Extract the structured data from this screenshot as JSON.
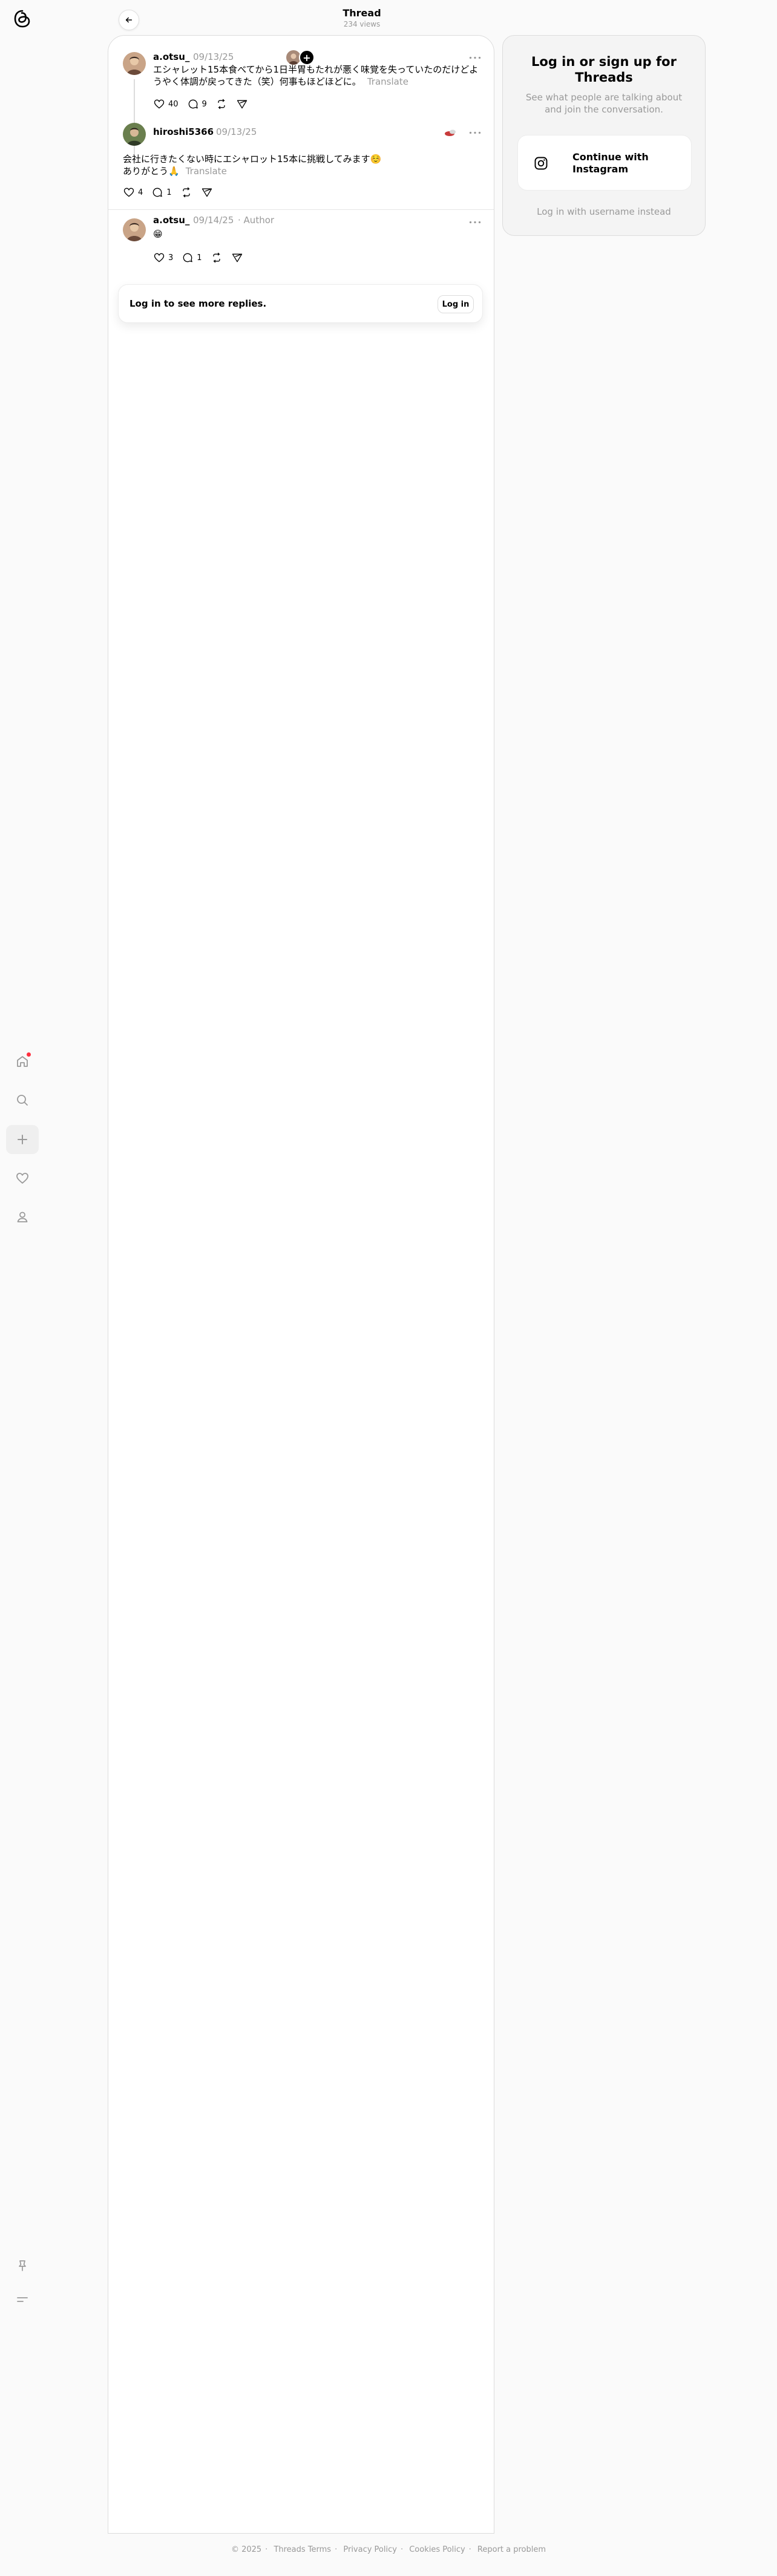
{
  "app": {
    "logo_icon": "threads-logo-icon"
  },
  "nav": {
    "items": [
      {
        "name": "home",
        "icon": "home-icon",
        "has_notification": true
      },
      {
        "name": "search",
        "icon": "search-icon"
      },
      {
        "name": "create",
        "icon": "plus-icon"
      },
      {
        "name": "activity",
        "icon": "heart-icon"
      },
      {
        "name": "profile",
        "icon": "person-icon"
      }
    ],
    "bottom": [
      {
        "name": "pin",
        "icon": "pin-icon"
      },
      {
        "name": "menu",
        "icon": "menu-icon"
      }
    ]
  },
  "header": {
    "title": "Thread",
    "views": "234 views",
    "back_icon": "arrow-left-icon"
  },
  "posts": [
    {
      "username": "a.otsu_",
      "date": "09/13/25",
      "text": "エシャレット15本食べてから1日半胃もたれが悪く味覚を失っていたのだけどようやく体調が戻ってきた（笑）何事もほどほどに。",
      "translate": "Translate",
      "likes": "40",
      "replies": "9",
      "thread_continues": true
    },
    {
      "username": "hiroshi5366",
      "date": "09/13/25",
      "text_line1": "会社に行きたくない時にエシャロット15本に挑戦してみます☺️",
      "text_line2": "ありがとう🙏",
      "translate": "Translate",
      "likes": "4",
      "replies": "1"
    },
    {
      "username": "a.otsu_",
      "date": "09/14/25",
      "badge": "Author",
      "text": "😁",
      "likes": "3",
      "replies": "1"
    }
  ],
  "login_prompt": {
    "text": "Log in to see more replies.",
    "button": "Log in"
  },
  "side_panel": {
    "title": "Log in or sign up for Threads",
    "subtitle": "See what people are talking about and join the conversation.",
    "instagram_button": "Continue with Instagram",
    "alt_login": "Log in with username instead"
  },
  "footer": {
    "copyright": "© 2025",
    "links": [
      "Threads Terms",
      "Privacy Policy",
      "Cookies Policy",
      "Report a problem"
    ]
  }
}
